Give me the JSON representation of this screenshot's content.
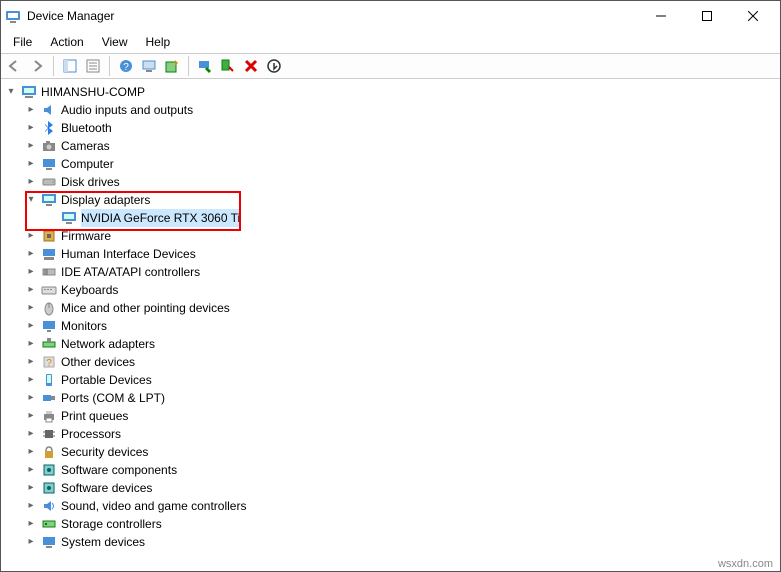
{
  "window": {
    "title": "Device Manager"
  },
  "menu": {
    "file": "File",
    "action": "Action",
    "view": "View",
    "help": "Help"
  },
  "tree": {
    "root": "HIMANSHU-COMP",
    "audio": "Audio inputs and outputs",
    "bluetooth": "Bluetooth",
    "cameras": "Cameras",
    "computer": "Computer",
    "disk": "Disk drives",
    "display": "Display adapters",
    "display_child": "NVIDIA GeForce RTX 3060 Ti",
    "firmware": "Firmware",
    "hid": "Human Interface Devices",
    "ide": "IDE ATA/ATAPI controllers",
    "keyboards": "Keyboards",
    "mice": "Mice and other pointing devices",
    "monitors": "Monitors",
    "network": "Network adapters",
    "other": "Other devices",
    "portable": "Portable Devices",
    "ports": "Ports (COM & LPT)",
    "printq": "Print queues",
    "processors": "Processors",
    "security": "Security devices",
    "softcomp": "Software components",
    "softdev": "Software devices",
    "sound": "Sound, video and game controllers",
    "storage": "Storage controllers",
    "system": "System devices"
  },
  "attribution": "wsxdn.com"
}
